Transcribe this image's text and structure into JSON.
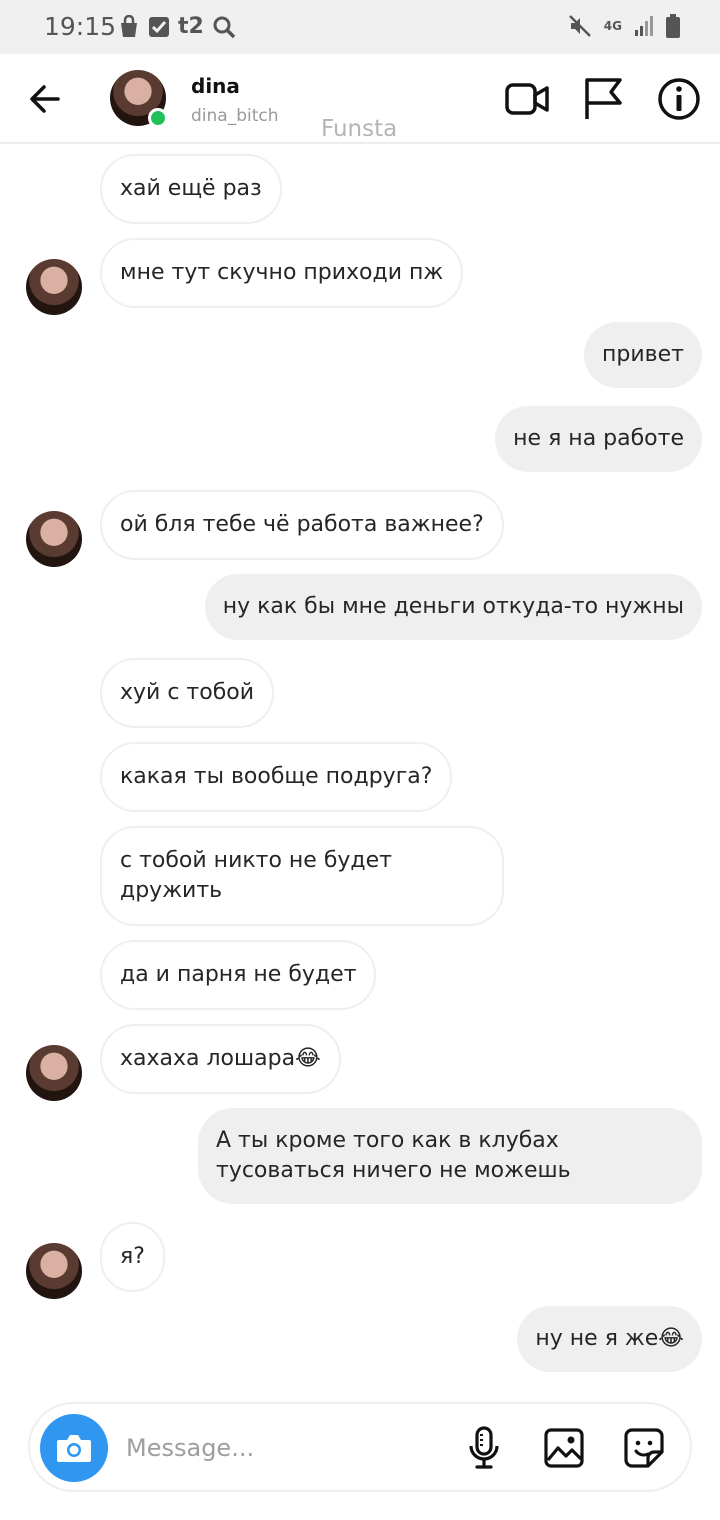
{
  "status_bar": {
    "time": "19:15",
    "carrier": "t2",
    "network": "4G",
    "icons": [
      "shopping-bag-icon",
      "checkbox-icon",
      "search-icon",
      "mute-icon",
      "signal-icon",
      "battery-icon"
    ]
  },
  "header": {
    "name": "dina",
    "username": "dina_bitch",
    "watermark": "Funsta",
    "online": true,
    "actions": [
      "video-call-icon",
      "flag-icon",
      "info-icon"
    ]
  },
  "messages": [
    {
      "from": "them",
      "text": "хай ещё раз",
      "avatar": false
    },
    {
      "from": "them",
      "text": "мне тут скучно приходи пж",
      "avatar": true
    },
    {
      "from": "me",
      "text": "привет"
    },
    {
      "from": "me",
      "text": "не я на работе"
    },
    {
      "from": "them",
      "text": "ой бля тебе чё работа важнее?",
      "avatar": true
    },
    {
      "from": "me",
      "text": "ну как бы мне деньги откуда-то нужны"
    },
    {
      "from": "them",
      "text": "хуй с тобой",
      "avatar": false
    },
    {
      "from": "them",
      "text": "какая ты вообще подруга?",
      "avatar": false
    },
    {
      "from": "them",
      "text": "с тобой никто не будет дружить",
      "avatar": false
    },
    {
      "from": "them",
      "text": "да и парня не будет",
      "avatar": false
    },
    {
      "from": "them",
      "text": "хахаха лошара😂",
      "avatar": true
    },
    {
      "from": "me",
      "text": "А ты кроме того как в клубах тусоваться ничего не можешь"
    },
    {
      "from": "them",
      "text": "я?",
      "avatar": true
    },
    {
      "from": "me",
      "text": "ну не я же😂"
    }
  ],
  "composer": {
    "placeholder": "Message...",
    "icons": [
      "camera-icon",
      "microphone-icon",
      "gallery-icon",
      "sticker-icon"
    ]
  },
  "colors": {
    "accent_blue": "#2f97ef",
    "online_green": "#21c15a",
    "outgoing_bubble": "#efefef",
    "incoming_border": "#efefef"
  }
}
